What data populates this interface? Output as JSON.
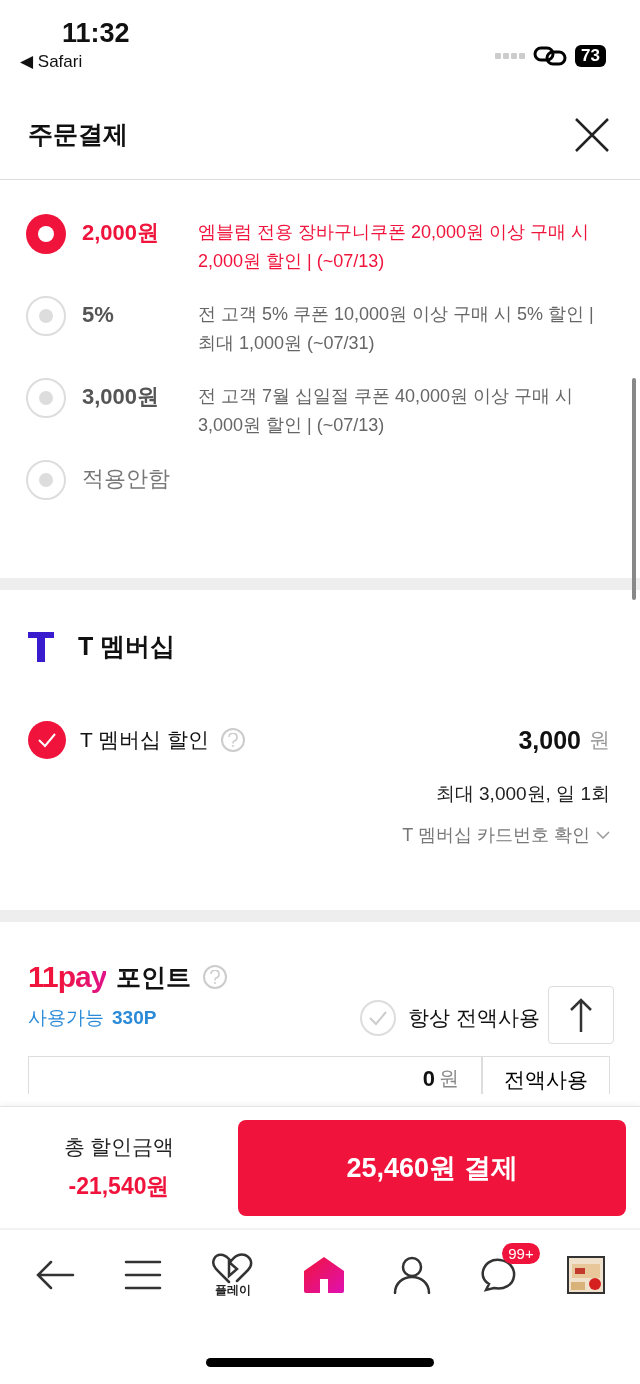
{
  "status_bar": {
    "time": "11:32",
    "back_label": "◀ Safari",
    "battery": "73"
  },
  "header": {
    "title": "주문결제"
  },
  "coupons": [
    {
      "amount": "2,000원",
      "description": "엠블럼 전용 장바구니쿠폰 20,000원 이상 구매 시 2,000원 할인 | (~07/13)",
      "selected": true
    },
    {
      "amount": "5%",
      "description": "전 고객 5% 쿠폰 10,000원 이상 구매 시 5% 할인 | 최대 1,000원 (~07/31)",
      "selected": false
    },
    {
      "amount": "3,000원",
      "description": "전 고객 7월 십일절 쿠폰 40,000원 이상 구매 시 3,000원 할인 | (~07/13)",
      "selected": false
    },
    {
      "amount": "적용안함",
      "selected": false
    }
  ],
  "t_membership": {
    "title": "T 멤버십",
    "label": "T 멤버십 할인",
    "checked": true,
    "amount": "3,000",
    "unit": "원",
    "limit": "최대 3,000원, 일 1회",
    "card_link": "T 멤버십 카드번호 확인"
  },
  "pay_points": {
    "logo": "11pay",
    "title": "포인트",
    "available_label": "사용가능",
    "available": "330P",
    "always_all": {
      "label": "항상 전액사용",
      "checked": false
    },
    "value": "0",
    "unit": "원",
    "use_all_button": "전액사용"
  },
  "summary": {
    "label": "총 할인금액",
    "amount": "-21,540원",
    "pay_button": "25,460원 결제"
  },
  "nav": [
    {
      "kind": "back"
    },
    {
      "kind": "menu"
    },
    {
      "kind": "play",
      "label": "플레이"
    },
    {
      "kind": "home"
    },
    {
      "kind": "profile"
    },
    {
      "kind": "chat",
      "badge": "99+"
    },
    {
      "kind": "thumbnail"
    }
  ]
}
